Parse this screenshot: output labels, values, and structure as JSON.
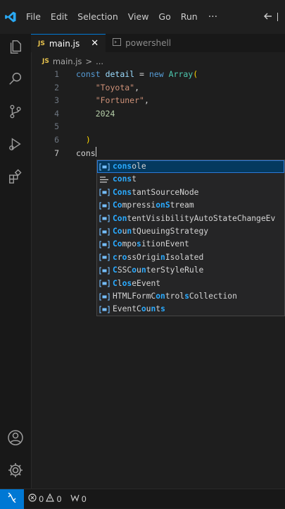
{
  "menu": {
    "items": [
      "File",
      "Edit",
      "Selection",
      "View",
      "Go",
      "Run"
    ],
    "more": "···",
    "back_icon": "arrow-left-icon"
  },
  "activity": {
    "icons": [
      "files-icon",
      "search-icon",
      "source-control-icon",
      "run-debug-icon",
      "extensions-icon"
    ],
    "bottom_icons": [
      "account-icon",
      "gear-icon"
    ]
  },
  "tabs": [
    {
      "label": "main.js",
      "badge": "JS",
      "active": true,
      "close": "✕"
    },
    {
      "label": "powershell",
      "active": false
    }
  ],
  "breadcrumb": {
    "badge": "JS",
    "file": "main.js",
    "sep": ">",
    "rest": "..."
  },
  "editor": {
    "lines": [
      {
        "num": "1",
        "tokens": [
          [
            "kw",
            "const"
          ],
          [
            "plain",
            " "
          ],
          [
            "var",
            "detail"
          ],
          [
            "op",
            " = "
          ],
          [
            "kw",
            "new"
          ],
          [
            "plain",
            " "
          ],
          [
            "cls",
            "Array"
          ],
          [
            "paren",
            "("
          ]
        ]
      },
      {
        "num": "2",
        "tokens": [
          [
            "plain",
            "    "
          ],
          [
            "str",
            "\"Toyota\""
          ],
          [
            "op",
            ","
          ]
        ]
      },
      {
        "num": "3",
        "tokens": [
          [
            "plain",
            "    "
          ],
          [
            "str",
            "\"Fortuner\""
          ],
          [
            "op",
            ","
          ]
        ]
      },
      {
        "num": "4",
        "tokens": [
          [
            "plain",
            "    "
          ],
          [
            "num",
            "2024"
          ]
        ]
      },
      {
        "num": "5",
        "tokens": []
      },
      {
        "num": "6",
        "tokens": [
          [
            "plain",
            "  "
          ],
          [
            "paren",
            ")"
          ]
        ]
      },
      {
        "num": "7",
        "tokens": [
          [
            "plain",
            "cons"
          ]
        ],
        "current": true
      }
    ]
  },
  "suggestions": [
    {
      "match": "cons",
      "rest": "ole",
      "icon": "variable-icon",
      "selected": true
    },
    {
      "match": "cons",
      "rest": "t",
      "icon": "keyword-icon"
    },
    {
      "parts": [
        [
          "Cons",
          1
        ],
        [
          "tantSourceNode",
          0
        ]
      ],
      "icon": "variable-icon"
    },
    {
      "parts": [
        [
          "Co",
          1
        ],
        [
          "mpressi",
          0
        ],
        [
          "onS",
          1
        ],
        [
          "tream",
          0
        ]
      ],
      "icon": "variable-icon"
    },
    {
      "parts": [
        [
          "Con",
          1
        ],
        [
          "tentVisibilityAutoStateChangeEv",
          0
        ]
      ],
      "icon": "variable-icon"
    },
    {
      "parts": [
        [
          "Co",
          1
        ],
        [
          "u",
          0
        ],
        [
          "n",
          1
        ],
        [
          "tQueuingStrategy",
          0
        ]
      ],
      "icon": "variable-icon"
    },
    {
      "parts": [
        [
          "Co",
          1
        ],
        [
          "mpo",
          0
        ],
        [
          "s",
          1
        ],
        [
          "itionEvent",
          0
        ]
      ],
      "icon": "variable-icon"
    },
    {
      "parts": [
        [
          "c",
          1
        ],
        [
          "r",
          0
        ],
        [
          "o",
          1
        ],
        [
          "ssOrigi",
          0
        ],
        [
          "n",
          1
        ],
        [
          "Isolated",
          0
        ]
      ],
      "icon": "variable-icon"
    },
    {
      "parts": [
        [
          "C",
          1
        ],
        [
          "SSC",
          0
        ],
        [
          "o",
          1
        ],
        [
          "u",
          0
        ],
        [
          "n",
          1
        ],
        [
          "terStyleRule",
          0
        ]
      ],
      "icon": "variable-icon"
    },
    {
      "parts": [
        [
          "C",
          1
        ],
        [
          "l",
          0
        ],
        [
          "o",
          1
        ],
        [
          "s",
          1
        ],
        [
          "eEvent",
          0
        ]
      ],
      "icon": "variable-icon"
    },
    {
      "parts": [
        [
          "HTMLFormC",
          0
        ],
        [
          "o",
          1
        ],
        [
          "n",
          1
        ],
        [
          "trol",
          0
        ],
        [
          "s",
          1
        ],
        [
          "Collection",
          0
        ]
      ],
      "icon": "variable-icon"
    },
    {
      "parts": [
        [
          "EventC",
          0
        ],
        [
          "o",
          1
        ],
        [
          "u",
          0
        ],
        [
          "n",
          1
        ],
        [
          "t",
          0
        ],
        [
          "s",
          1
        ]
      ],
      "icon": "variable-icon"
    }
  ],
  "status": {
    "errors": "0",
    "warnings": "0",
    "ports": "0",
    "remote_icon": "remote-icon"
  },
  "colors": {
    "accent": "#0078d4",
    "js_badge": "#e8c34d",
    "highlight": "#2aaaff"
  }
}
